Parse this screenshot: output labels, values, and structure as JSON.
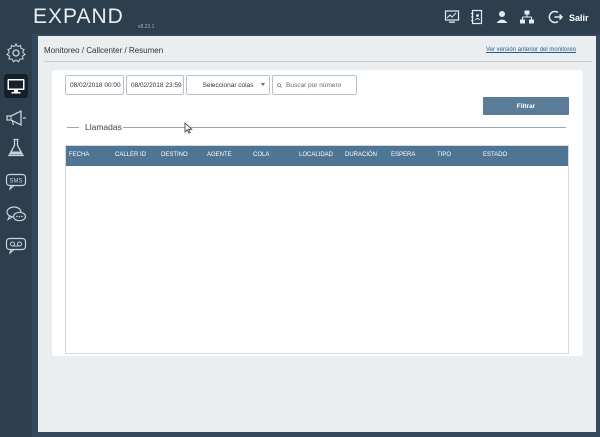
{
  "app": {
    "logo": "EXPAND",
    "version": "v8.22.1"
  },
  "topbar": {
    "icons": [
      "monitor-chart-icon",
      "contacts-book-icon",
      "user-icon",
      "org-chart-icon",
      "logout-icon"
    ],
    "logout_label": "Salir"
  },
  "sidebar": {
    "items": [
      {
        "icon": "gear-icon"
      },
      {
        "icon": "monitor-icon",
        "active": true
      },
      {
        "icon": "megaphone-icon"
      },
      {
        "icon": "flask-icon"
      },
      {
        "icon": "sms-icon",
        "text": "SMS"
      },
      {
        "icon": "chat-bubbles-icon"
      },
      {
        "icon": "voicemail-icon"
      }
    ]
  },
  "page": {
    "breadcrumb": "Monitoreo / Callcenter / Resumen",
    "old_version_link": "Ver versión anterior del monitoreo"
  },
  "filters": {
    "date_from": "08/02/2018 00:00",
    "date_to": "08/02/2018 23:59",
    "queue_select": "Seleccionar colas",
    "search_placeholder": "Buscar por número",
    "filter_button": "Filtrar"
  },
  "calls": {
    "title": "Llamadas",
    "columns": [
      "FECHA",
      "CALLER ID",
      "DESTINO",
      "AGENTE",
      "COLA",
      "LOCALIDAD",
      "DURACIÓN",
      "ESPERA",
      "TIPO",
      "ESTADO"
    ],
    "rows": []
  },
  "colors": {
    "sidebar_bg": "#2d3e4f",
    "content_bg": "#eaeef1",
    "table_header": "#4f7594",
    "button": "#5b7c98",
    "link": "#2a5d86"
  }
}
